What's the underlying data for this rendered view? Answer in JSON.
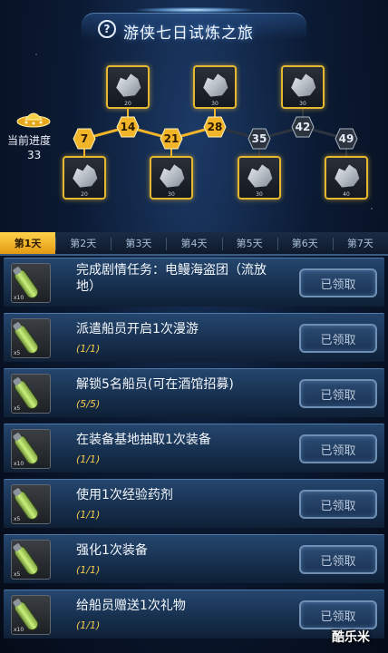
{
  "header": {
    "title": "游侠七日试炼之旅",
    "help_symbol": "?"
  },
  "progress_map": {
    "current_label": "当前进度",
    "current_value": "33",
    "nodes": [
      "7",
      "14",
      "21",
      "28",
      "35",
      "42",
      "49"
    ],
    "reached_count": 4,
    "rewards": [
      {
        "qty": "20"
      },
      {
        "qty": "20"
      },
      {
        "qty": "30"
      },
      {
        "qty": "30"
      },
      {
        "qty": "30"
      },
      {
        "qty": "30"
      },
      {
        "qty": "40"
      }
    ],
    "colors": {
      "reached": "#f2b428",
      "locked": "#2c3440",
      "line": "#f2b428"
    }
  },
  "tabs": [
    "第1天",
    "第2天",
    "第3天",
    "第4天",
    "第5天",
    "第6天",
    "第7天"
  ],
  "active_tab": 0,
  "tasks": [
    {
      "title": "完成剧情任务：电鳗海盗团（流放地）",
      "progress": "",
      "icon_qty": "x10",
      "button": "已领取"
    },
    {
      "title": "派遣船员开启1次漫游",
      "progress": "(1/1)",
      "icon_qty": "x5",
      "button": "已领取"
    },
    {
      "title": "解锁5名船员(可在酒馆招募)",
      "progress": "(5/5)",
      "icon_qty": "x5",
      "button": "已领取"
    },
    {
      "title": "在装备基地抽取1次装备",
      "progress": "(1/1)",
      "icon_qty": "x10",
      "button": "已领取"
    },
    {
      "title": "使用1次经验药剂",
      "progress": "(1/1)",
      "icon_qty": "x5",
      "button": "已领取"
    },
    {
      "title": "强化1次装备",
      "progress": "(1/1)",
      "icon_qty": "x5",
      "button": "已领取"
    },
    {
      "title": "给船员赠送1次礼物",
      "progress": "(1/1)",
      "icon_qty": "x10",
      "button": "已领取"
    }
  ],
  "watermark": "酷乐米"
}
